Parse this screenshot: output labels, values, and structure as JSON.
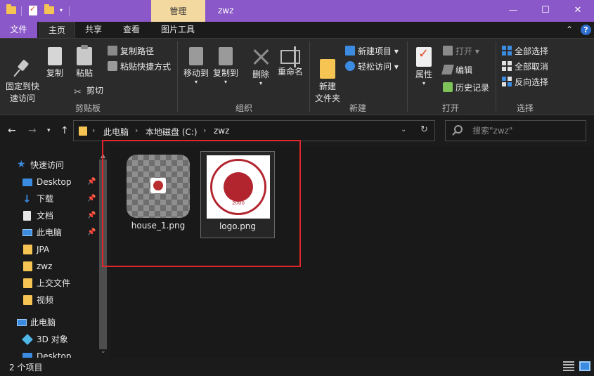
{
  "titlebar": {
    "context_tab": "管理",
    "window_title": "zwz",
    "minimize": "—",
    "maximize": "☐",
    "close": "✕"
  },
  "tabs": {
    "file": "文件",
    "home": "主页",
    "share": "共享",
    "view": "查看",
    "picture_tools": "图片工具",
    "collapse": "⌃"
  },
  "ribbon": {
    "clipboard": {
      "group_label": "剪贴板",
      "pin": "固定到快\n速访问",
      "copy": "复制",
      "paste": "粘贴",
      "copy_path": "复制路径",
      "paste_shortcut": "粘贴快捷方式",
      "cut": "剪切"
    },
    "organize": {
      "group_label": "组织",
      "move_to": "移动到",
      "copy_to": "复制到",
      "delete": "删除",
      "rename": "重命名"
    },
    "new": {
      "group_label": "新建",
      "new_folder": "新建\n文件夹",
      "new_item": "新建项目",
      "easy_access": "轻松访问"
    },
    "open": {
      "group_label": "打开",
      "properties": "属性",
      "open": "打开",
      "edit": "编辑",
      "history": "历史记录"
    },
    "select": {
      "group_label": "选择",
      "select_all": "全部选择",
      "select_none": "全部取消",
      "invert": "反向选择"
    }
  },
  "address": {
    "crumbs": [
      "此电脑",
      "本地磁盘 (C:)",
      "zwz"
    ],
    "search_placeholder": "搜索\"zwz\""
  },
  "nav_pane": {
    "quick_access": "快速访问",
    "items": [
      "Desktop",
      "下载",
      "文档",
      "此电脑",
      "JPA",
      "zwz",
      "上交文件",
      "视频"
    ],
    "this_pc": "此电脑",
    "pc_items": [
      "3D 对象",
      "Desktop"
    ]
  },
  "files": [
    {
      "name": "house_1.png",
      "icon": "image-thumbnail"
    },
    {
      "name": "logo.png",
      "icon": "image-thumbnail",
      "selected": true
    }
  ],
  "logo": {
    "year": "2000"
  },
  "status": {
    "item_count": "2 个项目"
  },
  "colors": {
    "accent": "#8a58c8",
    "highlight": "#e0262a",
    "folder": "#f5c452"
  }
}
